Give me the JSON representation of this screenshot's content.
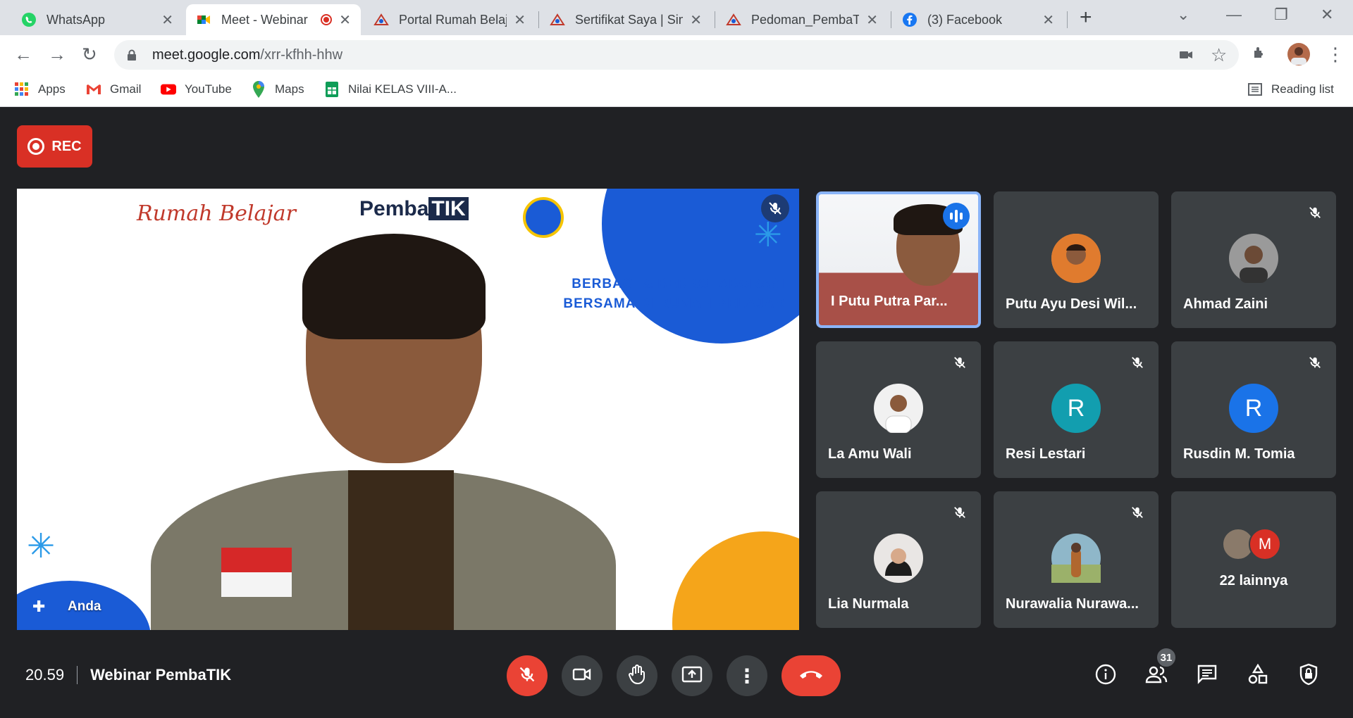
{
  "browser": {
    "tabs": [
      {
        "title": "WhatsApp",
        "icon": "whatsapp-icon",
        "active": false
      },
      {
        "title": "Meet - Webinar",
        "icon": "google-meet-icon",
        "active": true,
        "recording": true
      },
      {
        "title": "Portal Rumah Belajar",
        "icon": "rumah-belajar-icon",
        "active": false
      },
      {
        "title": "Sertifikat Saya | Sim",
        "icon": "rumah-belajar-icon",
        "active": false
      },
      {
        "title": "Pedoman_PembaTIK",
        "icon": "rumah-belajar-icon",
        "active": false
      },
      {
        "title": "(3) Facebook",
        "icon": "facebook-icon",
        "active": false
      }
    ],
    "url_host": "meet.google.com",
    "url_path": "/xrr-kfhh-hhw",
    "bookmarks": [
      {
        "label": "Apps",
        "icon": "apps-grid-icon"
      },
      {
        "label": "Gmail",
        "icon": "gmail-icon"
      },
      {
        "label": "YouTube",
        "icon": "youtube-icon"
      },
      {
        "label": "Maps",
        "icon": "maps-icon"
      },
      {
        "label": "Nilai KELAS VIII-A...",
        "icon": "sheets-icon"
      }
    ],
    "reading_list": "Reading list"
  },
  "meet": {
    "rec_label": "REC",
    "main": {
      "name": "Anda",
      "logo_left": "Rumah Belajar",
      "logo_center_a": "Pemba",
      "logo_center_b": "TIK",
      "banner_line1": "BERBAGI & BERKOLABORASI",
      "banner_line2": "BERSAMA DI RUMAH BELAJAR"
    },
    "participants": [
      {
        "name": "I Putu Putra Par...",
        "speaking": true
      },
      {
        "name": "Putu Ayu Desi Wil...",
        "avatar_color": "#c98a5a"
      },
      {
        "name": "Ahmad Zaini",
        "muted": true,
        "avatar_color": "#6b6b6b"
      },
      {
        "name": "La Amu Wali",
        "muted": true,
        "avatar_color": "#e8e8e8"
      },
      {
        "name": "Resi Lestari",
        "muted": true,
        "initial": "R",
        "avatar_color": "#129eaf"
      },
      {
        "name": "Rusdin M. Tomia",
        "muted": true,
        "initial": "R",
        "avatar_color": "#1a73e8"
      },
      {
        "name": "Lia Nurmala",
        "muted": true,
        "avatar_color": "#e9e6e4"
      },
      {
        "name": "Nurawalia Nurawa...",
        "muted": true,
        "avatar_color": "#c99a6a"
      }
    ],
    "more": {
      "label": "22 lainnya",
      "initial": "M",
      "initial_color": "#d93025"
    },
    "time": "20.59",
    "meeting_title": "Webinar PembaTIK",
    "participant_count": "31"
  }
}
